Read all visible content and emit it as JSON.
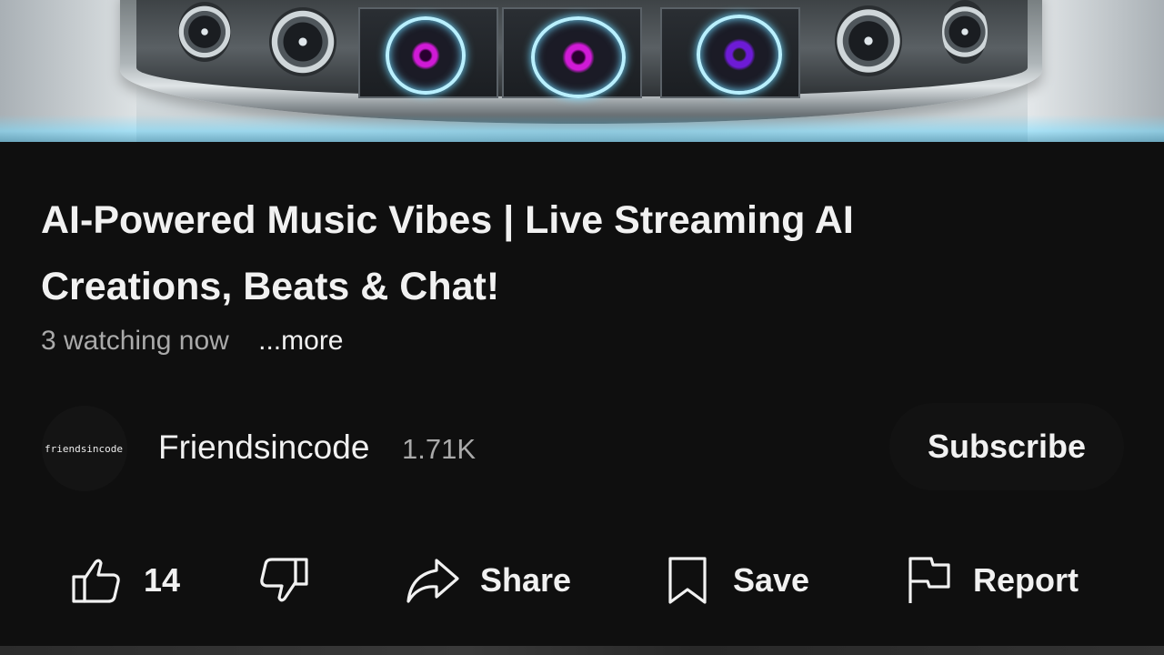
{
  "video": {
    "title": "AI-Powered Music Vibes | Live Streaming AI Creations, Beats & Chat!",
    "watching": "3 watching now",
    "more_label": "...more"
  },
  "channel": {
    "avatar_text": "friendsincode",
    "name": "Friendsincode",
    "subscribers": "1.71K",
    "subscribe_label": "Subscribe"
  },
  "actions": {
    "like_count": "14",
    "share_label": "Share",
    "save_label": "Save",
    "report_label": "Report"
  },
  "icons": {
    "like": "thumbs-up-icon",
    "dislike": "thumbs-down-icon",
    "share": "share-arrow-icon",
    "save": "bookmark-icon",
    "report": "flag-icon"
  },
  "colors": {
    "background": "#0f0f0f",
    "text_primary": "#f1f1f1",
    "text_secondary": "#aaaaaa"
  }
}
